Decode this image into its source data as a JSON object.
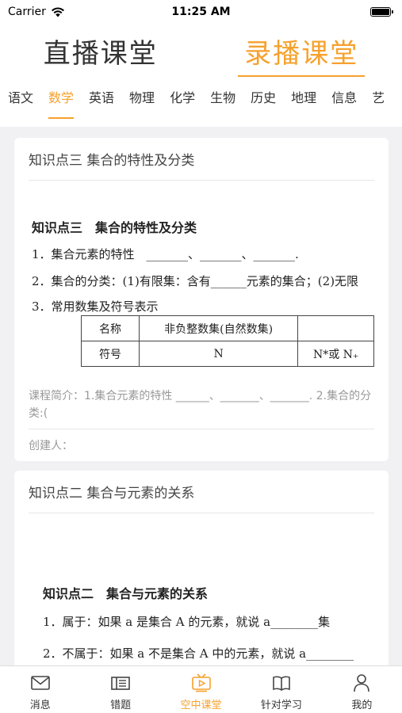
{
  "status_bar": {
    "carrier": "Carrier",
    "time": "11:25 AM",
    "battery_level": 1.0
  },
  "header": {
    "segments": [
      {
        "label": "直播课堂",
        "active": false
      },
      {
        "label": "录播课堂",
        "active": true
      }
    ]
  },
  "subjects": [
    {
      "label": "语文",
      "active": false
    },
    {
      "label": "数学",
      "active": true
    },
    {
      "label": "英语",
      "active": false
    },
    {
      "label": "物理",
      "active": false
    },
    {
      "label": "化学",
      "active": false
    },
    {
      "label": "生物",
      "active": false
    },
    {
      "label": "历史",
      "active": false
    },
    {
      "label": "地理",
      "active": false
    },
    {
      "label": "信息",
      "active": false
    },
    {
      "label": "艺",
      "active": false
    }
  ],
  "cards": [
    {
      "title": "知识点三 集合的特性及分类",
      "preview": {
        "heading": "知识点三　集合的特性及分类",
        "lines": [
          "1．集合元素的特性　_______、_______、_______.",
          "2．集合的分类：(1)有限集：含有______元素的集合；(2)无限",
          "3．常用数集及符号表示"
        ],
        "table": {
          "row1": [
            "名称",
            "非负整数集(自然数集)",
            ""
          ],
          "row2": [
            "符号",
            "N",
            "N*或 N₊"
          ]
        }
      },
      "description_label": "课程简介：",
      "description": "1.集合元素的特性 ______、_______、_______. 2.集合的分类:(",
      "creator_label": "创建人："
    },
    {
      "title": "知识点二 集合与元素的关系",
      "preview": {
        "heading": "知识点二　集合与元素的关系",
        "lines": [
          "1．属于：如果 a 是集合 A 的元素，就说 a________集",
          "2．不属于：如果 a 不是集合 A 中的元素，就说 a________"
        ]
      }
    }
  ],
  "tabbar": {
    "items": [
      {
        "label": "消息",
        "icon": "message-icon",
        "active": false
      },
      {
        "label": "错题",
        "icon": "wrong-questions-icon",
        "active": false
      },
      {
        "label": "空中课堂",
        "icon": "tv-icon",
        "active": true
      },
      {
        "label": "针对学习",
        "icon": "book-icon",
        "active": false
      },
      {
        "label": "我的",
        "icon": "person-icon",
        "active": false
      }
    ],
    "active_color": "#f6a12d"
  }
}
